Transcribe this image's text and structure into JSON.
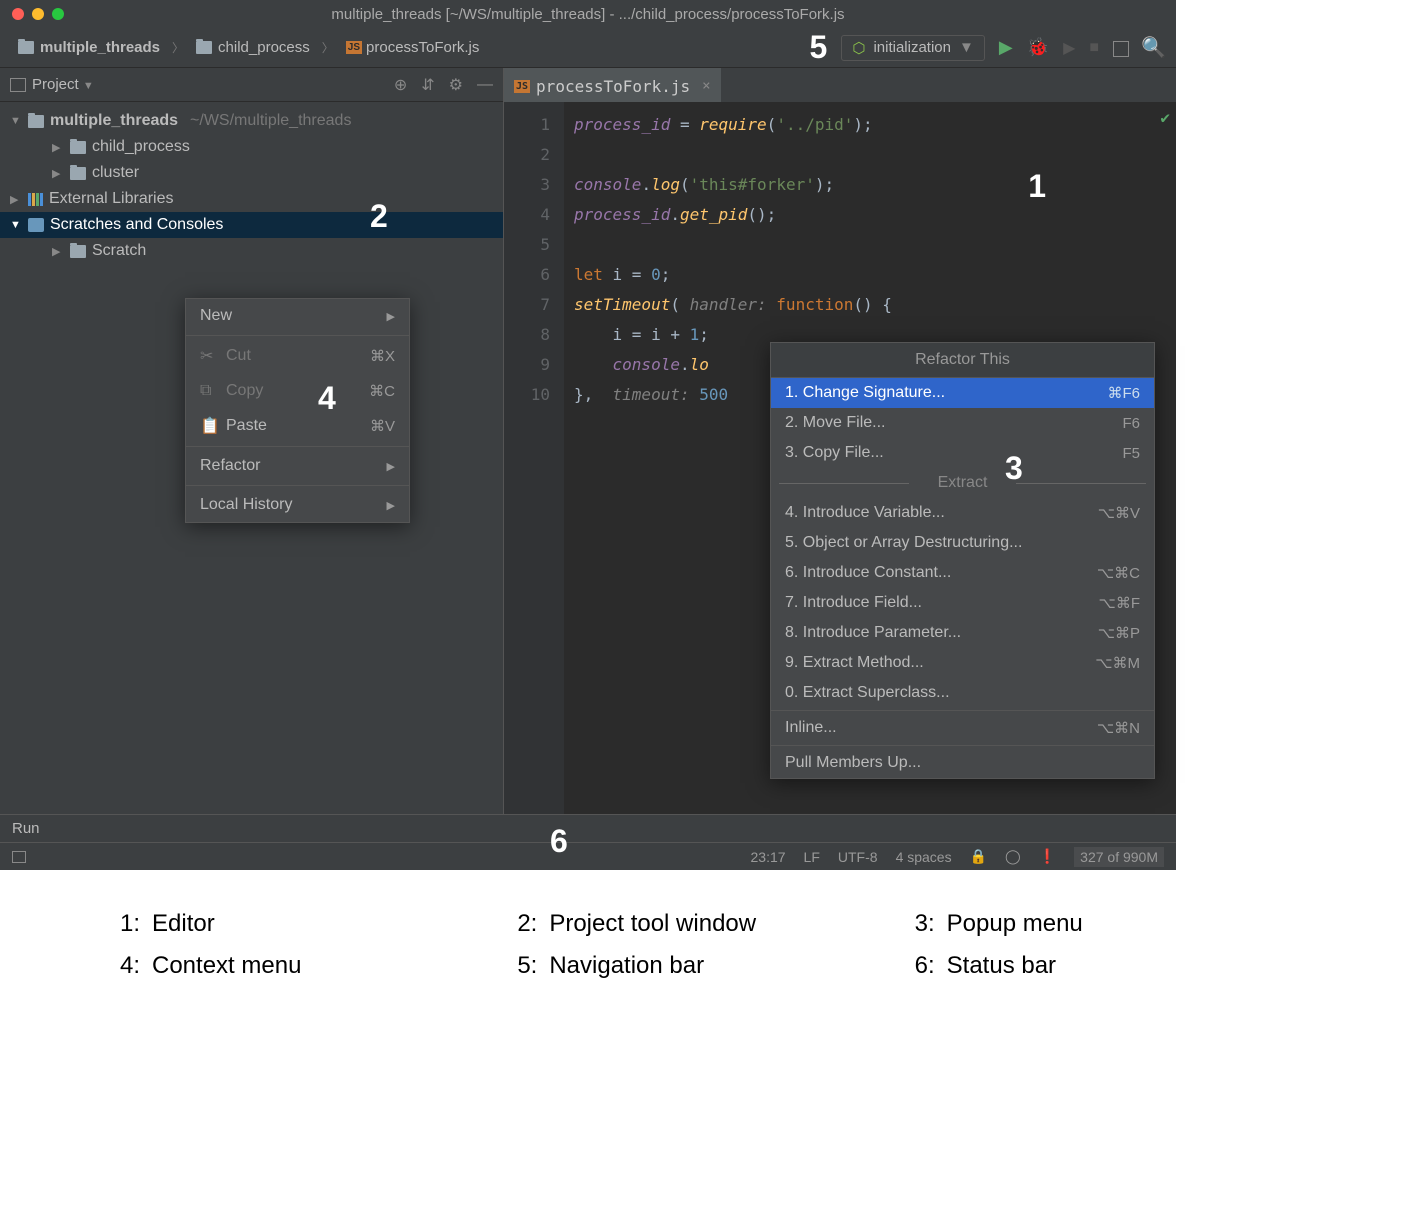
{
  "window": {
    "title": "multiple_threads [~/WS/multiple_threads] - .../child_process/processToFork.js"
  },
  "breadcrumbs": {
    "root": "multiple_threads",
    "folder": "child_process",
    "file": "processToFork.js"
  },
  "run_config": {
    "label": "initialization"
  },
  "project": {
    "panel_title": "Project",
    "root": "multiple_threads",
    "root_hint": "~/WS/multiple_threads",
    "child1": "child_process",
    "child2": "cluster",
    "ext_lib": "External Libraries",
    "scratches": "Scratches and Consoles",
    "scratch_child": "Scratch"
  },
  "context_menu": {
    "new": "New",
    "cut": "Cut",
    "cut_key": "⌘X",
    "copy": "Copy",
    "copy_key": "⌘C",
    "paste": "Paste",
    "paste_key": "⌘V",
    "refactor": "Refactor",
    "history": "Local History"
  },
  "editor": {
    "tab": "processToFork.js",
    "lines": [
      "1",
      "2",
      "3",
      "4",
      "5",
      "6",
      "7",
      "8",
      "9",
      "10"
    ]
  },
  "popup": {
    "title": "Refactor This",
    "items": [
      {
        "label": "1. Change Signature...",
        "key": "⌘F6",
        "hi": true
      },
      {
        "label": "2. Move File...",
        "key": "F6"
      },
      {
        "label": "3. Copy File...",
        "key": "F5"
      }
    ],
    "group": "Extract",
    "extract": [
      {
        "label": "4. Introduce Variable...",
        "key": "⌥⌘V"
      },
      {
        "label": "5. Object or Array Destructuring...",
        "key": ""
      },
      {
        "label": "6. Introduce Constant...",
        "key": "⌥⌘C"
      },
      {
        "label": "7. Introduce Field...",
        "key": "⌥⌘F"
      },
      {
        "label": "8. Introduce Parameter...",
        "key": "⌥⌘P"
      },
      {
        "label": "9. Extract Method...",
        "key": "⌥⌘M"
      },
      {
        "label": "0. Extract Superclass...",
        "key": ""
      }
    ],
    "inline": {
      "label": "Inline...",
      "key": "⌥⌘N"
    },
    "pull": {
      "label": "Pull Members Up...",
      "key": ""
    }
  },
  "run_panel": "Run",
  "status": {
    "pos": "23:17",
    "sep": "LF",
    "enc": "UTF-8",
    "indent": "4 spaces",
    "mem": "327 of 990M"
  },
  "annotations": {
    "a1": "1",
    "a2": "2",
    "a3": "3",
    "a4": "4",
    "a5": "5",
    "a6": "6"
  },
  "legend": {
    "l1": "Editor",
    "l2": "Project tool window",
    "l3": "Popup menu",
    "l4": "Context menu",
    "l5": "Navigation bar",
    "l6": "Status bar"
  }
}
